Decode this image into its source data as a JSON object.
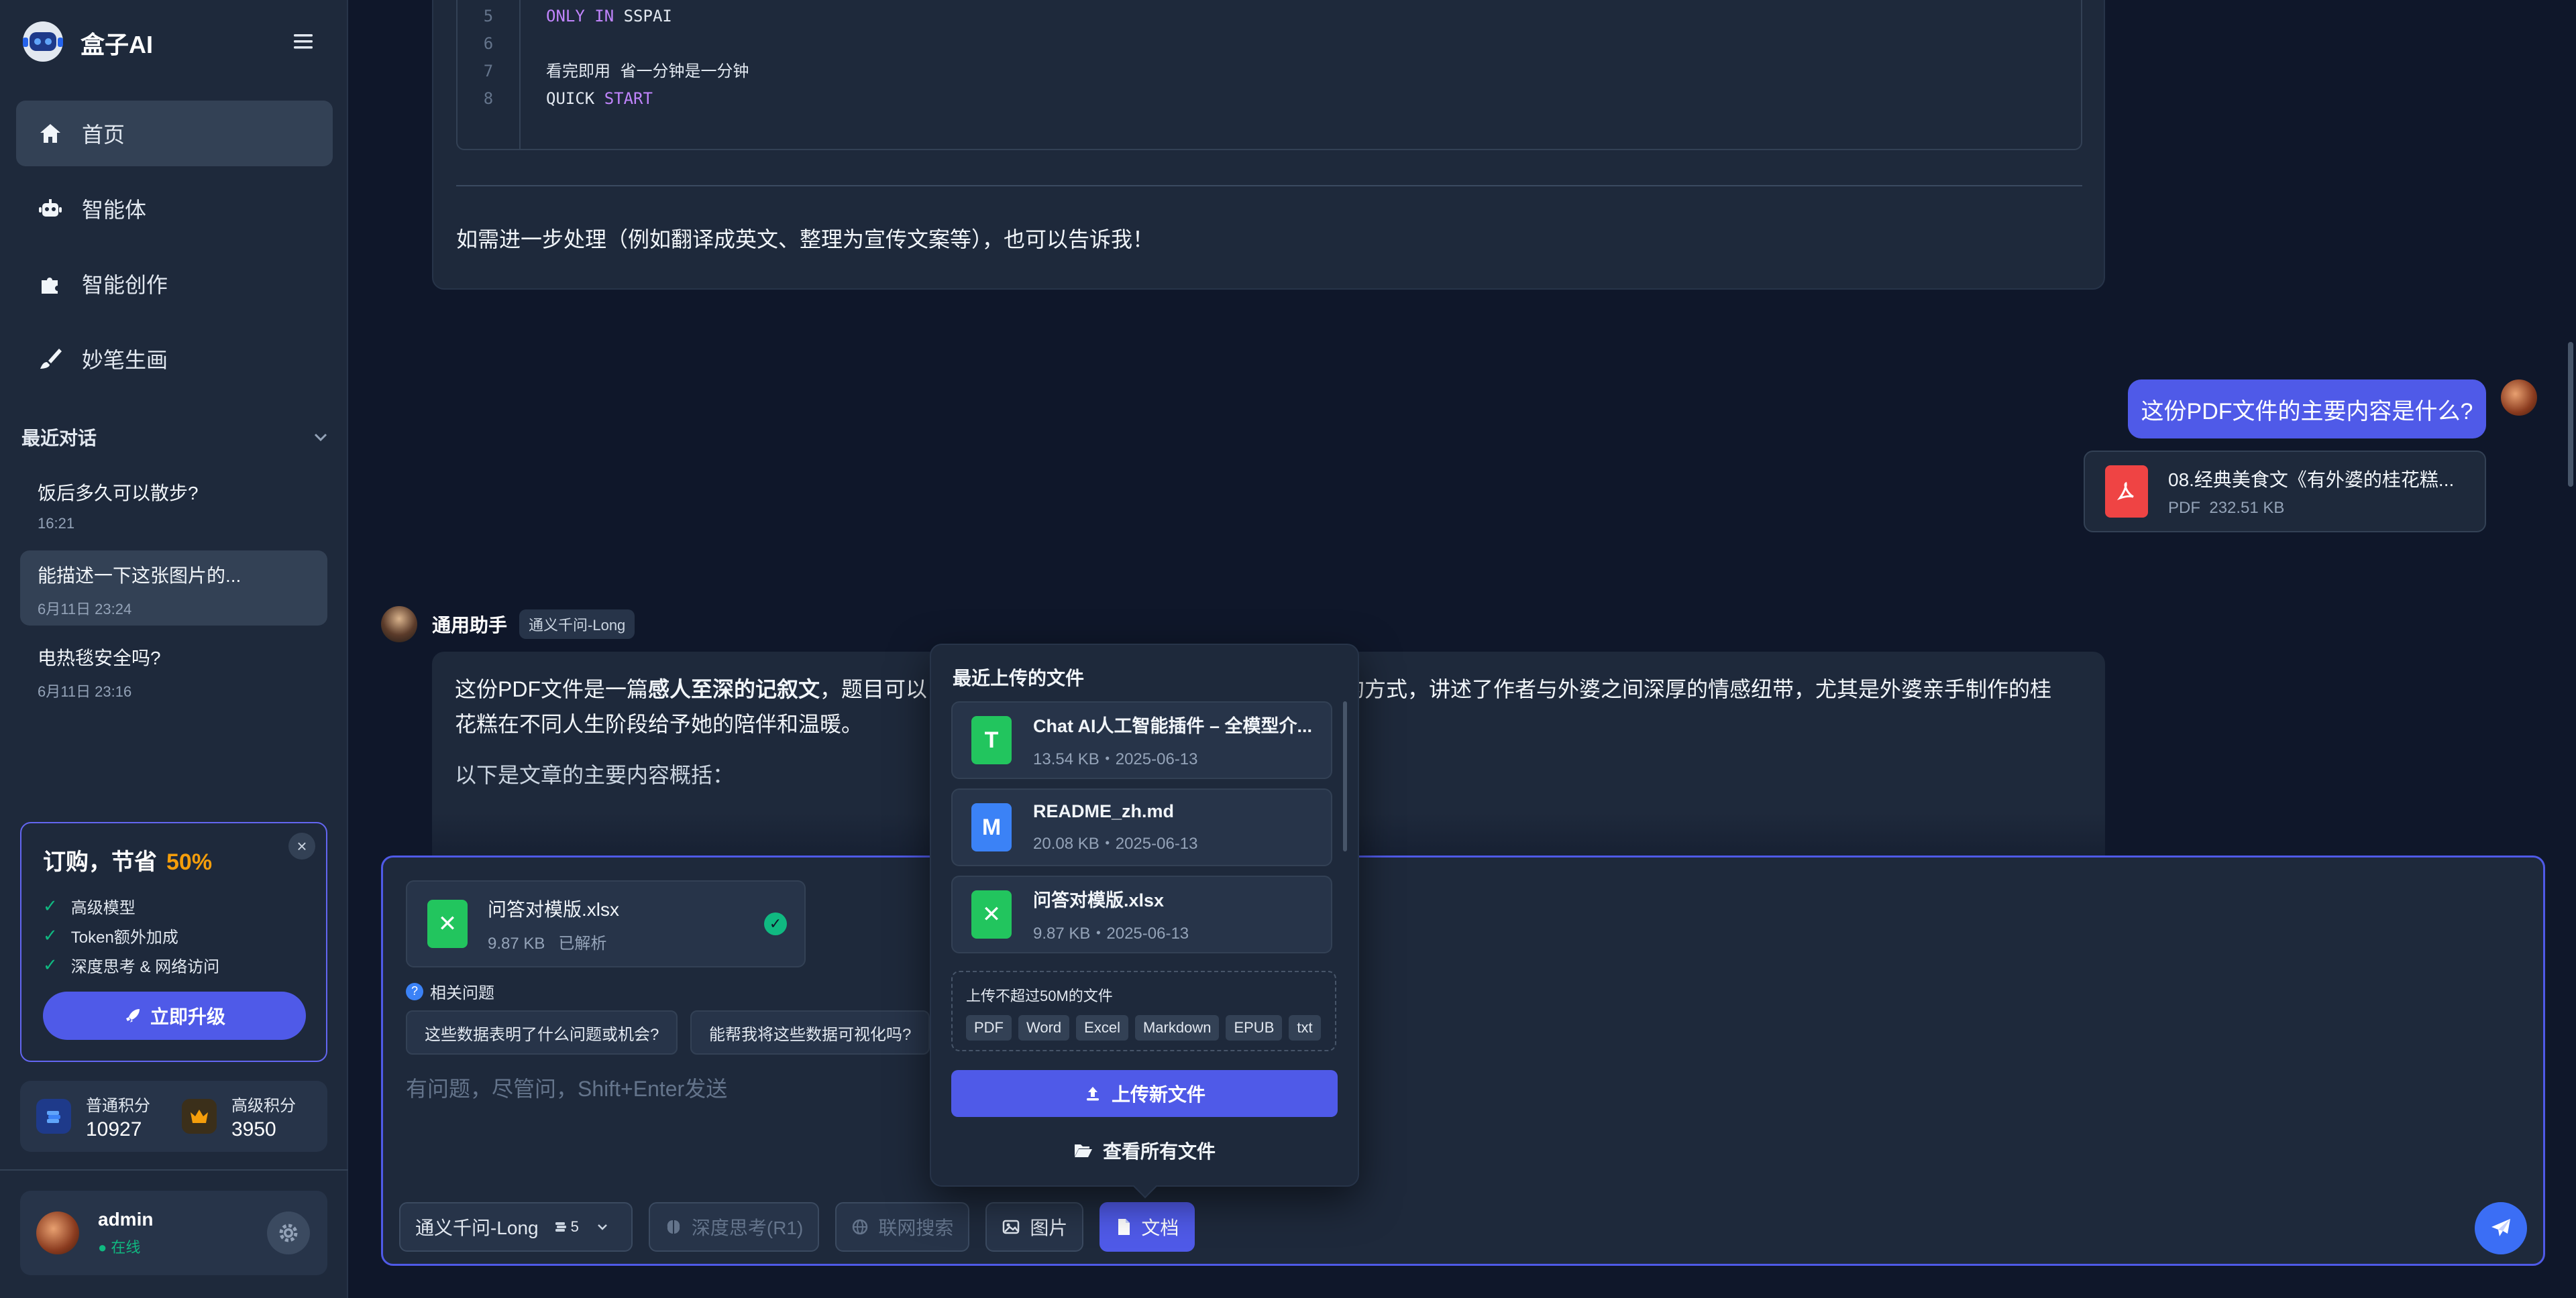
{
  "app": {
    "title": "盒子AI"
  },
  "nav": [
    {
      "label": "首页",
      "icon": "home-icon"
    },
    {
      "label": "智能体",
      "icon": "robot-icon"
    },
    {
      "label": "智能创作",
      "icon": "puzzle-icon"
    },
    {
      "label": "妙笔生画",
      "icon": "brush-icon"
    }
  ],
  "recent": {
    "header": "最近对话",
    "items": [
      {
        "title": "饭后多久可以散步?",
        "time": "16:21"
      },
      {
        "title": "能描述一下这张图片的...",
        "time": "6月11日 23:24"
      },
      {
        "title": "电热毯安全吗?",
        "time": "6月11日 23:16"
      }
    ]
  },
  "promo": {
    "title": "订购，节省",
    "percent": "50%",
    "features": [
      "高级模型",
      "Token额外加成",
      "深度思考 & 网络访问"
    ],
    "button": "立即升级"
  },
  "points": {
    "normal_label": "普通积分",
    "normal_value": "10927",
    "premium_label": "高级积分",
    "premium_value": "3950"
  },
  "user": {
    "name": "admin",
    "status": "在线"
  },
  "chat": {
    "code": {
      "line_numbers": [
        "5",
        "6",
        "7",
        "8"
      ],
      "line1_kw1": "ONLY",
      "line1_kw2": "IN",
      "line1_rest": "SSPAI",
      "line3": "看完即用 省一分钟是一分钟",
      "line4_a": "QUICK",
      "line4_kw": "START"
    },
    "continuation": "如需进一步处理（例如翻译成英文、整理为宣传文案等），也可以告诉我！",
    "user_message": "这份PDF文件的主要内容是什么?",
    "user_file": {
      "name": "08.经典美食文《有外婆的桂花糕...",
      "type": "PDF",
      "size": "232.51 KB"
    },
    "assistant_name": "通用助手",
    "assistant_model": "通义千问-Long",
    "reply_prefix": "这份PDF文件是一篇",
    "reply_bold": "感人至深的记叙文",
    "reply_mid": "，题目可以",
    "reply_right": "的方式，讲述了作者与外婆之间深厚的情感纽带，尤其是外婆亲手制作的桂",
    "reply_line2": "花糕在不同人生阶段给予她的陪伴和温暖。",
    "reply_p2": "以下是文章的主要内容概括："
  },
  "composer": {
    "attachment": {
      "name": "问答对模版.xlsx",
      "size": "9.87 KB",
      "status": "已解析"
    },
    "related_label": "相关问题",
    "suggestions": [
      "这些数据表明了什么问题或机会?",
      "能帮我将这些数据可视化吗?"
    ],
    "placeholder": "有问题，尽管问，Shift+Enter发送",
    "model": "通义千问-Long",
    "model_cost": "5",
    "deep_think": "深度思考(R1)",
    "web_search": "联网搜索",
    "image": "图片",
    "document": "文档"
  },
  "popover": {
    "title": "最近上传的文件",
    "files": [
      {
        "name": "Chat AI人工智能插件 – 全模型介...",
        "meta": "13.54 KB・2025-06-13",
        "icon_letter": "T",
        "color": "#22c55e"
      },
      {
        "name": "README_zh.md",
        "meta": "20.08 KB・2025-06-13",
        "icon_letter": "M",
        "color": "#3b82f6"
      },
      {
        "name": "问答对模版.xlsx",
        "meta": "9.87 KB・2025-06-13",
        "icon_letter": "✕",
        "color": "#22c55e"
      }
    ],
    "upload_hint": "上传不超过50M的文件",
    "types": [
      "PDF",
      "Word",
      "Excel",
      "Markdown",
      "EPUB",
      "txt"
    ],
    "upload_button": "上传新文件",
    "view_all": "查看所有文件"
  }
}
